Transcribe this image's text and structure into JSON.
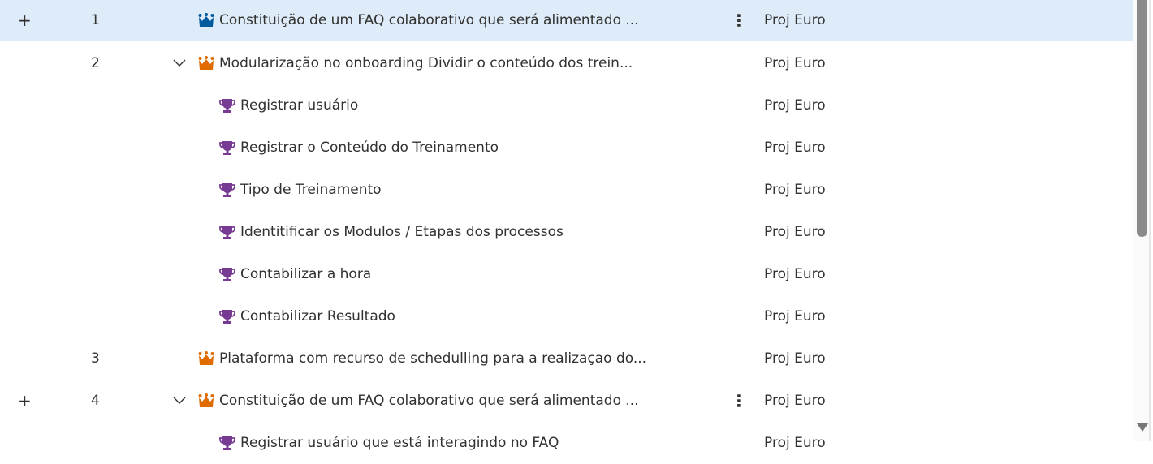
{
  "colors": {
    "epic_blue": "#005a9e",
    "epic_orange": "#e06c00",
    "feature_purple": "#773b93",
    "selected_row": "#deecf9"
  },
  "rows": [
    {
      "num": "1",
      "title": "Constituição de um FAQ colaborativo que será alimentado ...",
      "project": "Proj Euro",
      "type": "epic",
      "icon": "crown-icon",
      "color": "blue",
      "level": 0,
      "selected": true,
      "expander": false,
      "more": true
    },
    {
      "num": "2",
      "title": "Modularização no onboarding Dividir o conteúdo dos trein...",
      "project": "Proj Euro",
      "type": "epic",
      "icon": "crown-icon",
      "color": "orange",
      "level": 0,
      "expander": true
    },
    {
      "num": "",
      "title": "Registrar usuário",
      "project": "Proj Euro",
      "type": "feature",
      "icon": "trophy-icon",
      "level": 1
    },
    {
      "num": "",
      "title": "Registrar o Conteúdo do Treinamento",
      "project": "Proj Euro",
      "type": "feature",
      "icon": "trophy-icon",
      "level": 1
    },
    {
      "num": "",
      "title": "Tipo de Treinamento",
      "project": "Proj Euro",
      "type": "feature",
      "icon": "trophy-icon",
      "level": 1
    },
    {
      "num": "",
      "title": "Identitificar os Modulos / Etapas dos processos",
      "project": "Proj Euro",
      "type": "feature",
      "icon": "trophy-icon",
      "level": 1
    },
    {
      "num": "",
      "title": "Contabilizar a hora",
      "project": "Proj Euro",
      "type": "feature",
      "icon": "trophy-icon",
      "level": 1
    },
    {
      "num": "",
      "title": "Contabilizar Resultado",
      "project": "Proj Euro",
      "type": "feature",
      "icon": "trophy-icon",
      "level": 1
    },
    {
      "num": "3",
      "title": "Plataforma com recurso de schedulling para a realizaçao do...",
      "project": "Proj Euro",
      "type": "epic",
      "icon": "crown-icon",
      "color": "orange",
      "level": 0
    },
    {
      "num": "4",
      "title": "Constituição de um FAQ colaborativo que será alimentado ...",
      "project": "Proj Euro",
      "type": "epic",
      "icon": "crown-icon",
      "color": "orange",
      "level": 0,
      "expander": true,
      "more": true,
      "hover": true
    },
    {
      "num": "",
      "title": "Registrar usuário que está interagindo no FAQ",
      "project": "Proj Euro",
      "type": "feature",
      "icon": "trophy-icon",
      "level": 1
    }
  ],
  "labels": {
    "add": "+",
    "more": "⋮"
  }
}
